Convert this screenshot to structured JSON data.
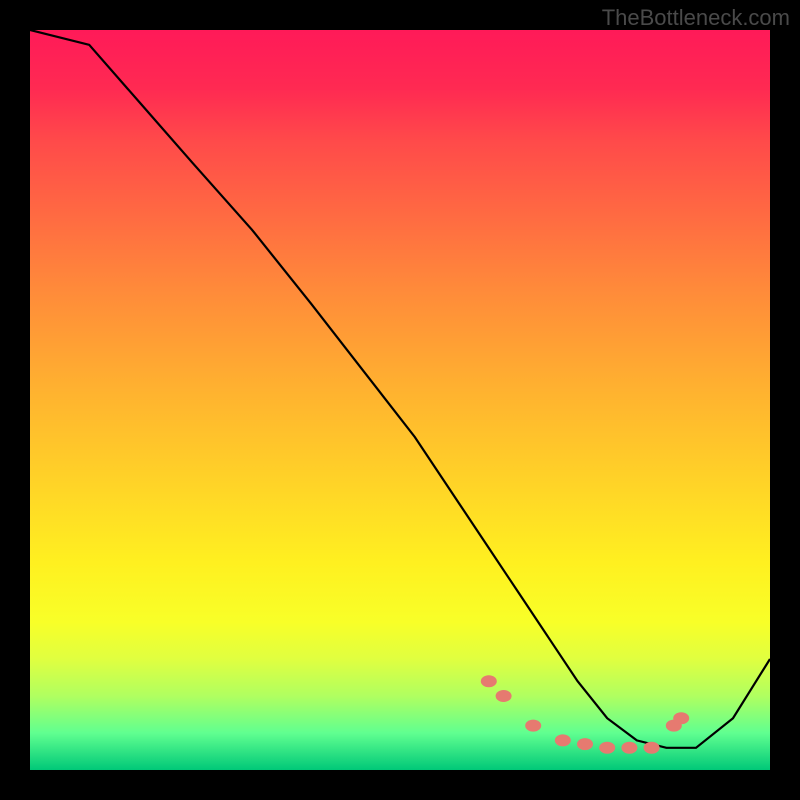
{
  "watermark": "TheBottleneck.com",
  "chart_data": {
    "type": "line",
    "title": "",
    "xlabel": "",
    "ylabel": "",
    "xlim": [
      0,
      100
    ],
    "ylim": [
      0,
      100
    ],
    "series": [
      {
        "name": "curve",
        "x": [
          0,
          8,
          15,
          22,
          30,
          38,
          45,
          52,
          58,
          62,
          66,
          70,
          74,
          78,
          82,
          86,
          90,
          95,
          100
        ],
        "y": [
          100,
          98,
          90,
          82,
          73,
          63,
          54,
          45,
          36,
          30,
          24,
          18,
          12,
          7,
          4,
          3,
          3,
          7,
          15
        ]
      }
    ],
    "markers": {
      "name": "dots",
      "x": [
        62,
        64,
        68,
        72,
        75,
        78,
        81,
        84,
        87,
        88
      ],
      "y": [
        12,
        10,
        6,
        4,
        3.5,
        3,
        3,
        3,
        6,
        7
      ]
    },
    "gradient_colors": {
      "top": "#ff1a58",
      "mid_upper": "#ff8a3a",
      "mid": "#ffd028",
      "mid_lower": "#f8ff28",
      "bottom": "#00c878"
    }
  }
}
